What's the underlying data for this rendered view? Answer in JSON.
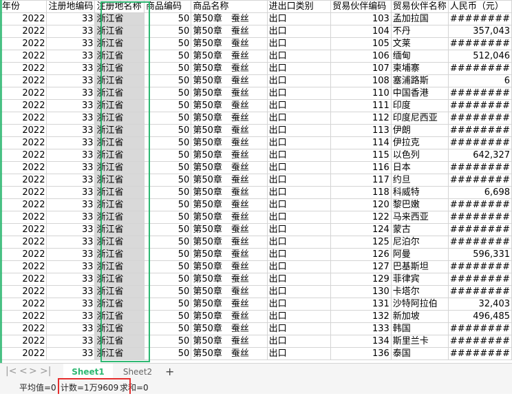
{
  "headers": [
    "年份",
    "注册地编码",
    "注册地名称",
    "商品编码",
    "商品名称",
    "进出口类别",
    "贸易伙伴编码",
    "贸易伙伴名称",
    "人民币（元）"
  ],
  "rows": [
    {
      "year": "2022",
      "reg_code": "33",
      "reg_name": "浙江省",
      "goods_code": "50",
      "goods_name": "第50章　蚕丝",
      "type": "出口",
      "partner_code": "103",
      "partner_name": "孟加拉国",
      "rmb": "########"
    },
    {
      "year": "2022",
      "reg_code": "33",
      "reg_name": "浙江省",
      "goods_code": "50",
      "goods_name": "第50章　蚕丝",
      "type": "出口",
      "partner_code": "104",
      "partner_name": "不丹",
      "rmb": "357,043"
    },
    {
      "year": "2022",
      "reg_code": "33",
      "reg_name": "浙江省",
      "goods_code": "50",
      "goods_name": "第50章　蚕丝",
      "type": "出口",
      "partner_code": "105",
      "partner_name": "文莱",
      "rmb": "########"
    },
    {
      "year": "2022",
      "reg_code": "33",
      "reg_name": "浙江省",
      "goods_code": "50",
      "goods_name": "第50章　蚕丝",
      "type": "出口",
      "partner_code": "106",
      "partner_name": "缅甸",
      "rmb": "512,046"
    },
    {
      "year": "2022",
      "reg_code": "33",
      "reg_name": "浙江省",
      "goods_code": "50",
      "goods_name": "第50章　蚕丝",
      "type": "出口",
      "partner_code": "107",
      "partner_name": "柬埔寨",
      "rmb": "########"
    },
    {
      "year": "2022",
      "reg_code": "33",
      "reg_name": "浙江省",
      "goods_code": "50",
      "goods_name": "第50章　蚕丝",
      "type": "出口",
      "partner_code": "108",
      "partner_name": "塞浦路斯",
      "rmb": "6"
    },
    {
      "year": "2022",
      "reg_code": "33",
      "reg_name": "浙江省",
      "goods_code": "50",
      "goods_name": "第50章　蚕丝",
      "type": "出口",
      "partner_code": "110",
      "partner_name": "中国香港",
      "rmb": "########"
    },
    {
      "year": "2022",
      "reg_code": "33",
      "reg_name": "浙江省",
      "goods_code": "50",
      "goods_name": "第50章　蚕丝",
      "type": "出口",
      "partner_code": "111",
      "partner_name": "印度",
      "rmb": "########"
    },
    {
      "year": "2022",
      "reg_code": "33",
      "reg_name": "浙江省",
      "goods_code": "50",
      "goods_name": "第50章　蚕丝",
      "type": "出口",
      "partner_code": "112",
      "partner_name": "印度尼西亚",
      "rmb": "########"
    },
    {
      "year": "2022",
      "reg_code": "33",
      "reg_name": "浙江省",
      "goods_code": "50",
      "goods_name": "第50章　蚕丝",
      "type": "出口",
      "partner_code": "113",
      "partner_name": "伊朗",
      "rmb": "########"
    },
    {
      "year": "2022",
      "reg_code": "33",
      "reg_name": "浙江省",
      "goods_code": "50",
      "goods_name": "第50章　蚕丝",
      "type": "出口",
      "partner_code": "114",
      "partner_name": "伊拉克",
      "rmb": "########"
    },
    {
      "year": "2022",
      "reg_code": "33",
      "reg_name": "浙江省",
      "goods_code": "50",
      "goods_name": "第50章　蚕丝",
      "type": "出口",
      "partner_code": "115",
      "partner_name": "以色列",
      "rmb": "642,327"
    },
    {
      "year": "2022",
      "reg_code": "33",
      "reg_name": "浙江省",
      "goods_code": "50",
      "goods_name": "第50章　蚕丝",
      "type": "出口",
      "partner_code": "116",
      "partner_name": "日本",
      "rmb": "########"
    },
    {
      "year": "2022",
      "reg_code": "33",
      "reg_name": "浙江省",
      "goods_code": "50",
      "goods_name": "第50章　蚕丝",
      "type": "出口",
      "partner_code": "117",
      "partner_name": "约旦",
      "rmb": "########"
    },
    {
      "year": "2022",
      "reg_code": "33",
      "reg_name": "浙江省",
      "goods_code": "50",
      "goods_name": "第50章　蚕丝",
      "type": "出口",
      "partner_code": "118",
      "partner_name": "科威特",
      "rmb": "6,698"
    },
    {
      "year": "2022",
      "reg_code": "33",
      "reg_name": "浙江省",
      "goods_code": "50",
      "goods_name": "第50章　蚕丝",
      "type": "出口",
      "partner_code": "120",
      "partner_name": "黎巴嫩",
      "rmb": "########"
    },
    {
      "year": "2022",
      "reg_code": "33",
      "reg_name": "浙江省",
      "goods_code": "50",
      "goods_name": "第50章　蚕丝",
      "type": "出口",
      "partner_code": "122",
      "partner_name": "马来西亚",
      "rmb": "########"
    },
    {
      "year": "2022",
      "reg_code": "33",
      "reg_name": "浙江省",
      "goods_code": "50",
      "goods_name": "第50章　蚕丝",
      "type": "出口",
      "partner_code": "124",
      "partner_name": "蒙古",
      "rmb": "########"
    },
    {
      "year": "2022",
      "reg_code": "33",
      "reg_name": "浙江省",
      "goods_code": "50",
      "goods_name": "第50章　蚕丝",
      "type": "出口",
      "partner_code": "125",
      "partner_name": "尼泊尔",
      "rmb": "########"
    },
    {
      "year": "2022",
      "reg_code": "33",
      "reg_name": "浙江省",
      "goods_code": "50",
      "goods_name": "第50章　蚕丝",
      "type": "出口",
      "partner_code": "126",
      "partner_name": "阿曼",
      "rmb": "596,331"
    },
    {
      "year": "2022",
      "reg_code": "33",
      "reg_name": "浙江省",
      "goods_code": "50",
      "goods_name": "第50章　蚕丝",
      "type": "出口",
      "partner_code": "127",
      "partner_name": "巴基斯坦",
      "rmb": "########"
    },
    {
      "year": "2022",
      "reg_code": "33",
      "reg_name": "浙江省",
      "goods_code": "50",
      "goods_name": "第50章　蚕丝",
      "type": "出口",
      "partner_code": "129",
      "partner_name": "菲律宾",
      "rmb": "########"
    },
    {
      "year": "2022",
      "reg_code": "33",
      "reg_name": "浙江省",
      "goods_code": "50",
      "goods_name": "第50章　蚕丝",
      "type": "出口",
      "partner_code": "130",
      "partner_name": "卡塔尔",
      "rmb": "########"
    },
    {
      "year": "2022",
      "reg_code": "33",
      "reg_name": "浙江省",
      "goods_code": "50",
      "goods_name": "第50章　蚕丝",
      "type": "出口",
      "partner_code": "131",
      "partner_name": "沙特阿拉伯",
      "rmb": "32,403"
    },
    {
      "year": "2022",
      "reg_code": "33",
      "reg_name": "浙江省",
      "goods_code": "50",
      "goods_name": "第50章　蚕丝",
      "type": "出口",
      "partner_code": "132",
      "partner_name": "新加坡",
      "rmb": "496,485"
    },
    {
      "year": "2022",
      "reg_code": "33",
      "reg_name": "浙江省",
      "goods_code": "50",
      "goods_name": "第50章　蚕丝",
      "type": "出口",
      "partner_code": "133",
      "partner_name": "韩国",
      "rmb": "########"
    },
    {
      "year": "2022",
      "reg_code": "33",
      "reg_name": "浙江省",
      "goods_code": "50",
      "goods_name": "第50章　蚕丝",
      "type": "出口",
      "partner_code": "134",
      "partner_name": "斯里兰卡",
      "rmb": "########"
    },
    {
      "year": "2022",
      "reg_code": "33",
      "reg_name": "浙江省",
      "goods_code": "50",
      "goods_name": "第50章　蚕丝",
      "type": "出口",
      "partner_code": "136",
      "partner_name": "泰国",
      "rmb": "########"
    }
  ],
  "tabs": {
    "nav_first": "|<",
    "nav_prev": "<",
    "nav_next": ">",
    "nav_last": ">|",
    "sheet1": "Sheet1",
    "sheet2": "Sheet2",
    "add": "+"
  },
  "status": {
    "average": "平均值=0",
    "count": "计数=1万9609",
    "sum": "求和=0"
  },
  "colors": {
    "selection": "#2eb872",
    "count_highlight": "#e52e2e",
    "selected_fill": "#d9d9d9"
  }
}
